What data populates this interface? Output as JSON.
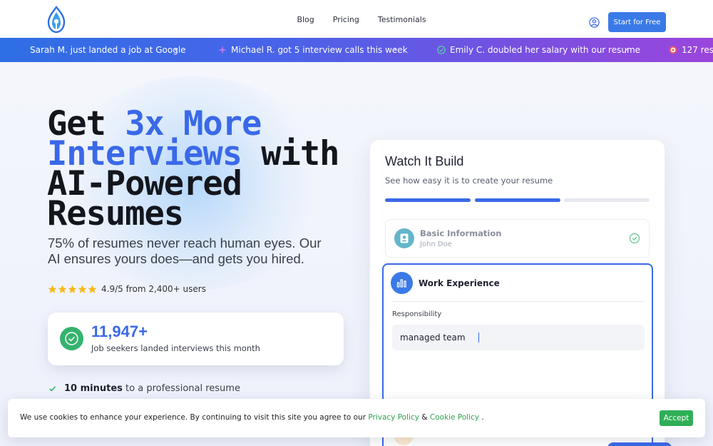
{
  "header": {
    "nav": [
      "Blog",
      "Pricing",
      "Testimonials"
    ],
    "cta": "Start for Free"
  },
  "ticker": [
    {
      "text": "Sarah M. just landed a job at Google",
      "icon": "none"
    },
    {
      "text": "Michael R. got 5 interview calls this week",
      "icon": "sparkle-icon"
    },
    {
      "text": "Emily C. doubled her salary with our resume",
      "icon": "check-circle-icon"
    },
    {
      "text": "127 resum",
      "icon": "target-icon"
    }
  ],
  "hero": {
    "headline_1": "Get ",
    "headline_accent": "3x More Interviews",
    "headline_2": " with AI-Powered Resumes",
    "subhead": "75% of resumes never reach human eyes. Our AI ensures yours does—and gets you hired.",
    "rating": "4.9/5 from 2,400+ users",
    "stars": 5,
    "stat_number": "11,947+",
    "stat_label": "Job seekers landed interviews this month",
    "feature_bold": "10 minutes",
    "feature_text": " to a professional resume"
  },
  "builder": {
    "title": "Watch It Build",
    "subtitle": "See how easy it is to create your resume",
    "progress_steps_done": 2,
    "progress_steps_total": 3,
    "basic_title": "Basic Information",
    "basic_name": "John Doe",
    "work_title": "Work Experience",
    "resp_label": "Responsibility",
    "resp_value": "managed team"
  },
  "cookie": {
    "text_before": "We use cookies to enhance your experience. By continuing to visit this site you agree to our ",
    "privacy": "Privacy Policy",
    "amp": " & ",
    "cookie_policy": "Cookie Policy",
    "text_after": " .",
    "accept": "Accept"
  },
  "colors": {
    "accent": "#3a69e8",
    "cta": "#3a7ae8",
    "success": "#2fae57",
    "star": "#f5b91e"
  }
}
